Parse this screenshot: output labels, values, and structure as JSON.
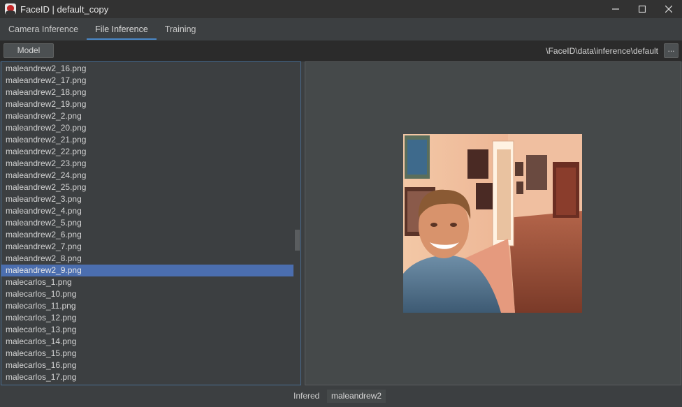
{
  "window": {
    "title": "FaceID | default_copy",
    "icon": "faceid-app-icon",
    "controls": [
      "minimize-icon",
      "maximize-icon",
      "close-icon"
    ]
  },
  "tabs": [
    {
      "label": "Camera Inference",
      "active": false
    },
    {
      "label": "File Inference",
      "active": true
    },
    {
      "label": "Training",
      "active": false
    }
  ],
  "toolbar": {
    "model_label": "Model",
    "path": "\\FaceID\\data\\inference\\default",
    "browse_label": "..."
  },
  "file_list": {
    "selected": "maleandrew2_9.png",
    "items": [
      "maleandrew2_16.png",
      "maleandrew2_17.png",
      "maleandrew2_18.png",
      "maleandrew2_19.png",
      "maleandrew2_2.png",
      "maleandrew2_20.png",
      "maleandrew2_21.png",
      "maleandrew2_22.png",
      "maleandrew2_23.png",
      "maleandrew2_24.png",
      "maleandrew2_25.png",
      "maleandrew2_3.png",
      "maleandrew2_4.png",
      "maleandrew2_5.png",
      "maleandrew2_6.png",
      "maleandrew2_7.png",
      "maleandrew2_8.png",
      "maleandrew2_9.png",
      "malecarlos_1.png",
      "malecarlos_10.png",
      "malecarlos_11.png",
      "malecarlos_12.png",
      "malecarlos_13.png",
      "malecarlos_14.png",
      "malecarlos_15.png",
      "malecarlos_16.png",
      "malecarlos_17.png"
    ]
  },
  "preview": {
    "image": "face-photo"
  },
  "status": {
    "label": "Infered",
    "value": "maleandrew2"
  },
  "colors": {
    "accent": "#4a88c7",
    "selection": "#4b6eaf",
    "background": "#3c3f41"
  }
}
